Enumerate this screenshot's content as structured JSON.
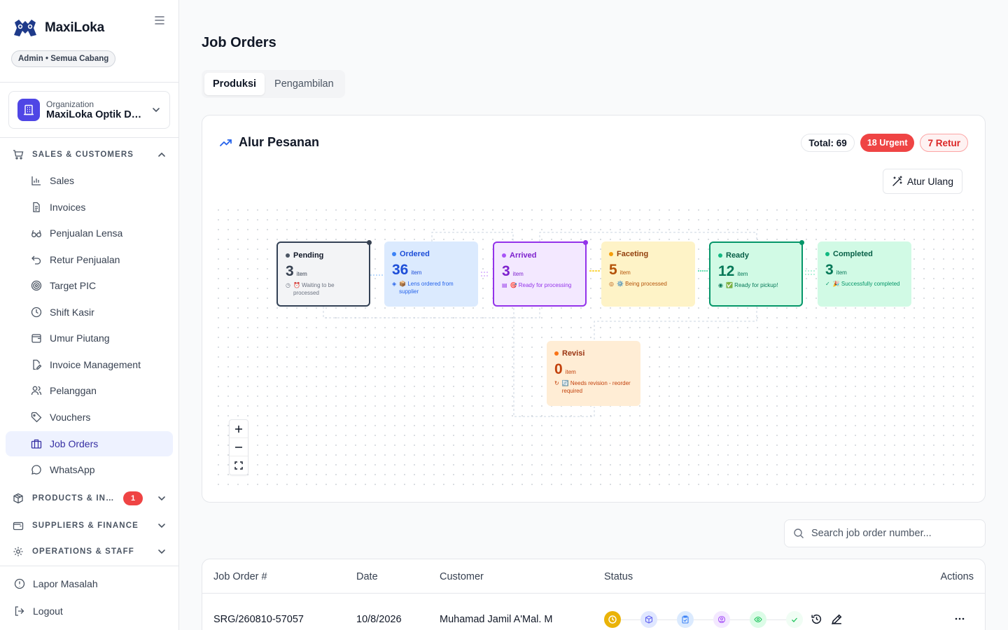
{
  "app": {
    "name": "MaxiLoka",
    "role": "Admin • Semua Cabang"
  },
  "organization": {
    "label": "Organization",
    "value": "MaxiLoka Optik De..."
  },
  "sidebar": {
    "sales_section": "SALES & CUSTOMERS",
    "items": [
      {
        "label": "Sales",
        "icon": "bar-chart-icon"
      },
      {
        "label": "Invoices",
        "icon": "document-icon"
      },
      {
        "label": "Penjualan Lensa",
        "icon": "glasses-icon"
      },
      {
        "label": "Retur Penjualan",
        "icon": "undo-icon"
      },
      {
        "label": "Target PIC",
        "icon": "target-icon"
      },
      {
        "label": "Shift Kasir",
        "icon": "clock-icon"
      },
      {
        "label": "Umur Piutang",
        "icon": "wallet-icon"
      },
      {
        "label": "Invoice Management",
        "icon": "file-edit-icon"
      },
      {
        "label": "Pelanggan",
        "icon": "users-icon"
      },
      {
        "label": "Vouchers",
        "icon": "tag-icon"
      },
      {
        "label": "Job Orders",
        "icon": "briefcase-icon",
        "active": true
      },
      {
        "label": "WhatsApp",
        "icon": "chat-icon"
      }
    ],
    "products_section": "PRODUCTS & INVEN...",
    "products_badge": "1",
    "suppliers_section": "SUPPLIERS & FINANCE",
    "operations_section": "OPERATIONS & STAFF",
    "report_issue": "Lapor Masalah",
    "logout": "Logout"
  },
  "main": {
    "title": "Job Orders",
    "tabs": [
      {
        "label": "Produksi",
        "active": true
      },
      {
        "label": "Pengambilan",
        "active": false
      }
    ]
  },
  "flow": {
    "title": "Alur Pesanan",
    "total": "Total: 69",
    "urgent": "18 Urgent",
    "retur": "7 Retur",
    "reset_label": "Atur Ulang",
    "unit": "item",
    "nodes": {
      "pending": {
        "title": "Pending",
        "count": "3",
        "desc": "⏰ Waiting to be processed",
        "color": "#374151"
      },
      "ordered": {
        "title": "Ordered",
        "count": "36",
        "desc": "📦 Lens ordered from supplier",
        "color": "#1d4ed8"
      },
      "arrived": {
        "title": "Arrived",
        "count": "3",
        "desc": "🎯 Ready for processing",
        "color": "#7e22ce"
      },
      "faceting": {
        "title": "Faceting",
        "count": "5",
        "desc": "⚙️ Being processed",
        "color": "#b45309"
      },
      "ready": {
        "title": "Ready",
        "count": "12",
        "desc": "✅ Ready for pickup!",
        "color": "#047857"
      },
      "completed": {
        "title": "Completed",
        "count": "3",
        "desc": "🎉 Successfully completed",
        "color": "#047857"
      },
      "revisi": {
        "title": "Revisi",
        "count": "0",
        "desc": "🔄 Needs revision - reorder required",
        "color": "#c2410c"
      }
    }
  },
  "search": {
    "placeholder": "Search job order number..."
  },
  "table": {
    "columns": [
      "Job Order #",
      "Date",
      "Customer",
      "Status",
      "Actions"
    ],
    "rows": [
      {
        "job_order": "SRG/260810-57057",
        "date": "10/8/2026",
        "customer": "Muhamad Jamil A'Mal. M"
      }
    ]
  }
}
